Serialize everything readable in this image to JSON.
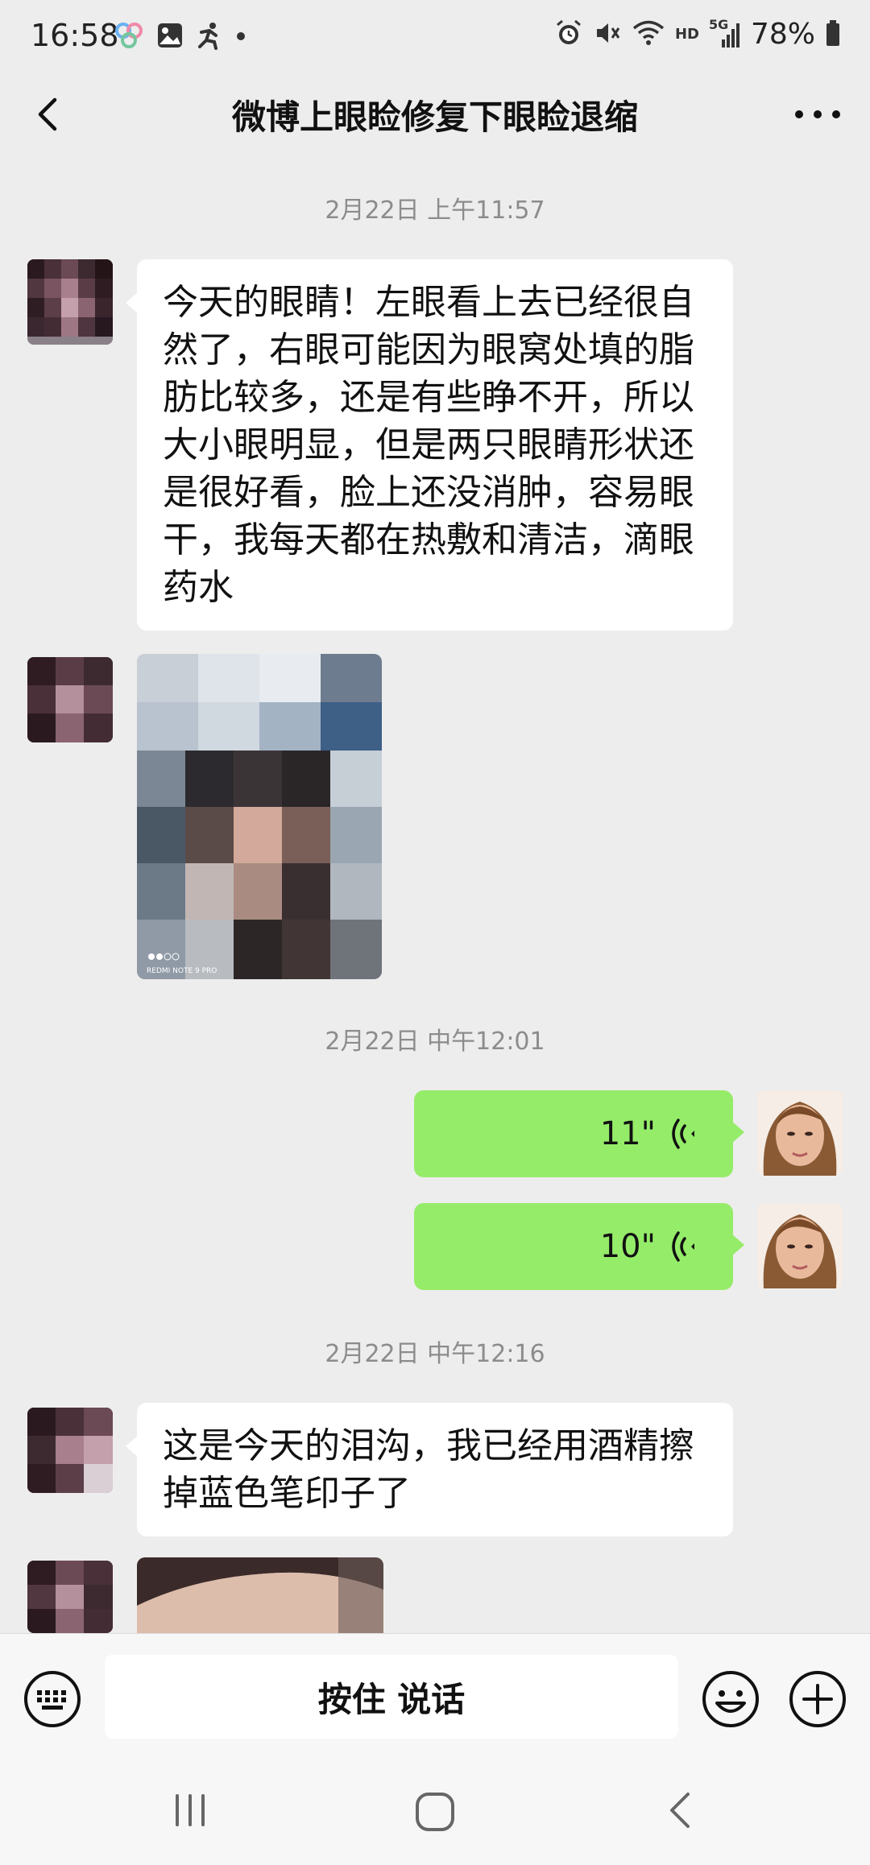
{
  "status_bar": {
    "time": "16:58",
    "battery": "78%",
    "network": "5G",
    "hd_label": "HD"
  },
  "header": {
    "title": "微博上眼睑修复下眼睑退缩"
  },
  "messages": [
    {
      "type": "timestamp",
      "text": "2月22日 上午11:57"
    },
    {
      "type": "text",
      "from": "other",
      "text": "今天的眼睛！左眼看上去已经很自然了，右眼可能因为眼窝处填的脂肪比较多，还是有些睁不开，所以大小眼明显，但是两只眼睛形状还是很好看，脸上还没消肿，容易眼干，我每天都在热敷和清洁，滴眼药水"
    },
    {
      "type": "image",
      "from": "other",
      "caption": "REDMI NOTE 9 PRO"
    },
    {
      "type": "timestamp",
      "text": "2月22日 中午12:01"
    },
    {
      "type": "voice",
      "from": "me",
      "duration": "11\""
    },
    {
      "type": "voice",
      "from": "me",
      "duration": "10\""
    },
    {
      "type": "timestamp",
      "text": "2月22日 中午12:16"
    },
    {
      "type": "text",
      "from": "other",
      "text": "这是今天的泪沟，我已经用酒精擦掉蓝色笔印子了"
    },
    {
      "type": "image",
      "from": "other"
    }
  ],
  "input_bar": {
    "hold_to_talk_label": "按住 说话"
  },
  "colors": {
    "chat_background": "#ededed",
    "outgoing_bubble": "#95ec69",
    "incoming_bubble": "#ffffff",
    "timestamp_text": "#8c8c8c"
  },
  "icons": {
    "back": "back-chevron-icon",
    "more": "more-dots-icon",
    "voice": "voice-wave-icon",
    "keyboard": "keyboard-icon",
    "emoji": "emoji-icon",
    "plus": "plus-icon"
  }
}
